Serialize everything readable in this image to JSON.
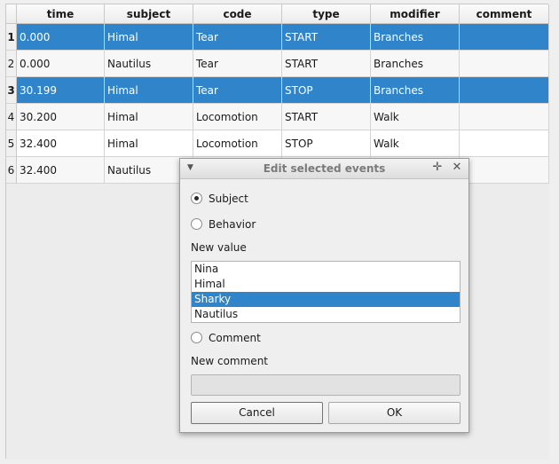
{
  "table": {
    "columns": [
      "time",
      "subject",
      "code",
      "type",
      "modifier",
      "comment"
    ],
    "rows": [
      {
        "num": "1",
        "cells": [
          "0.000",
          "Himal",
          "Tear",
          "START",
          "Branches",
          ""
        ],
        "selected": true
      },
      {
        "num": "2",
        "cells": [
          "0.000",
          "Nautilus",
          "Tear",
          "START",
          "Branches",
          ""
        ],
        "selected": false
      },
      {
        "num": "3",
        "cells": [
          "30.199",
          "Himal",
          "Tear",
          "STOP",
          "Branches",
          ""
        ],
        "selected": true
      },
      {
        "num": "4",
        "cells": [
          "30.200",
          "Himal",
          "Locomotion",
          "START",
          "Walk",
          ""
        ],
        "selected": false
      },
      {
        "num": "5",
        "cells": [
          "32.400",
          "Himal",
          "Locomotion",
          "STOP",
          "Walk",
          ""
        ],
        "selected": false
      },
      {
        "num": "6",
        "cells": [
          "32.400",
          "Nautilus",
          "",
          "",
          "",
          ""
        ],
        "selected": false
      }
    ]
  },
  "dialog": {
    "title": "Edit selected events",
    "radio_subject": "Subject",
    "radio_behavior": "Behavior",
    "new_value_label": "New value",
    "values": [
      "Nina",
      "Himal",
      "Sharky",
      "Nautilus"
    ],
    "selected_value": "Sharky",
    "radio_comment": "Comment",
    "new_comment_label": "New comment",
    "new_comment_value": "",
    "cancel_label": "Cancel",
    "ok_label": "OK"
  },
  "colors": {
    "selection": "#3084c9",
    "background": "#efefef"
  },
  "icons": [
    "menu-arrow-icon",
    "pin-icon",
    "close-icon"
  ]
}
